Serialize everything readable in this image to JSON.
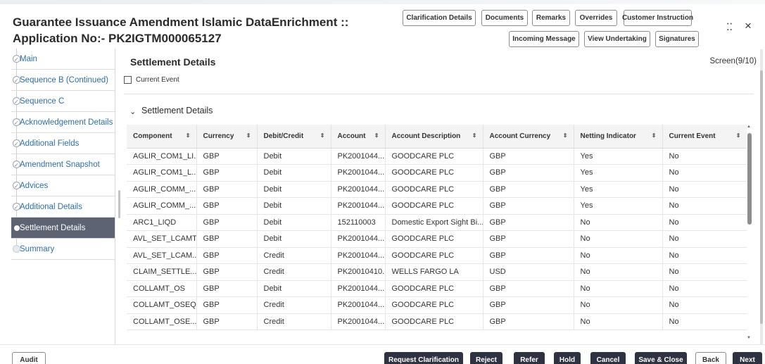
{
  "header": {
    "title_line1": "Guarantee Issuance Amendment Islamic DataEnrichment ::",
    "title_line2": "Application No:- PK2IGTM000065127",
    "buttons_row1": [
      "Clarification Details",
      "Documents",
      "Remarks",
      "Overrides",
      "Customer Instruction"
    ],
    "buttons_row2": [
      "Incoming Message",
      "View Undertaking",
      "Signatures"
    ],
    "restore_icon": "⁚⁚",
    "close_icon": "×"
  },
  "sidebar": {
    "items": [
      {
        "label": "Main",
        "state": "done"
      },
      {
        "label": "Sequence B (Continued)",
        "state": "done"
      },
      {
        "label": "Sequence C",
        "state": "done"
      },
      {
        "label": "Acknowledgement Details",
        "state": "done"
      },
      {
        "label": "Additional Fields",
        "state": "done"
      },
      {
        "label": "Amendment Snapshot",
        "state": "done"
      },
      {
        "label": "Advices",
        "state": "done"
      },
      {
        "label": "Additional Details",
        "state": "done"
      },
      {
        "label": "Settlement Details",
        "state": "active"
      },
      {
        "label": "Summary",
        "state": "future"
      }
    ]
  },
  "main": {
    "title": "Settlement Details",
    "screen_indicator": "Screen(9/10)",
    "current_event_label": "Current Event",
    "current_event_checked": false,
    "section": {
      "title": "Settlement Details",
      "chevron": "⌄"
    },
    "table": {
      "columns": [
        "Component",
        "Currency",
        "Debit/Credit",
        "Account",
        "Account Description",
        "Account Currency",
        "Netting Indicator",
        "Current Event"
      ],
      "sort_glyph": "⇕",
      "rows": [
        [
          "AGLIR_COM1_LI...",
          "GBP",
          "Debit",
          "PK2001044...",
          "GOODCARE PLC",
          "GBP",
          "Yes",
          "No"
        ],
        [
          "AGLIR_COM1_L...",
          "GBP",
          "Debit",
          "PK2001044...",
          "GOODCARE PLC",
          "GBP",
          "Yes",
          "No"
        ],
        [
          "AGLIR_COMM_...",
          "GBP",
          "Debit",
          "PK2001044...",
          "GOODCARE PLC",
          "GBP",
          "Yes",
          "No"
        ],
        [
          "AGLIR_COMM_...",
          "GBP",
          "Debit",
          "PK2001044...",
          "GOODCARE PLC",
          "GBP",
          "Yes",
          "No"
        ],
        [
          "ARC1_LIQD",
          "GBP",
          "Debit",
          "152110003",
          "Domestic Export Sight Bi...",
          "GBP",
          "No",
          "No"
        ],
        [
          "AVL_SET_LCAMT",
          "GBP",
          "Debit",
          "PK2001044...",
          "GOODCARE PLC",
          "GBP",
          "No",
          "No"
        ],
        [
          "AVL_SET_LCAM...",
          "GBP",
          "Credit",
          "PK2001044...",
          "GOODCARE PLC",
          "GBP",
          "No",
          "No"
        ],
        [
          "CLAIM_SETTLE...",
          "GBP",
          "Credit",
          "PK20010410...",
          "WELLS FARGO LA",
          "USD",
          "No",
          "No"
        ],
        [
          "COLLAMT_OS",
          "GBP",
          "Debit",
          "PK2001044...",
          "GOODCARE PLC",
          "GBP",
          "No",
          "No"
        ],
        [
          "COLLAMT_OSEQ",
          "GBP",
          "Credit",
          "PK2001044...",
          "GOODCARE PLC",
          "GBP",
          "No",
          "No"
        ],
        [
          "COLLAMT_OSE...",
          "GBP",
          "Credit",
          "PK2001044...",
          "GOODCARE PLC",
          "GBP",
          "No",
          "No"
        ]
      ]
    }
  },
  "footer": {
    "audit": "Audit",
    "buttons": [
      "Request Clarification",
      "Reject",
      "Refer",
      "Hold",
      "Cancel",
      "Save & Close",
      "Back",
      "Next"
    ]
  }
}
